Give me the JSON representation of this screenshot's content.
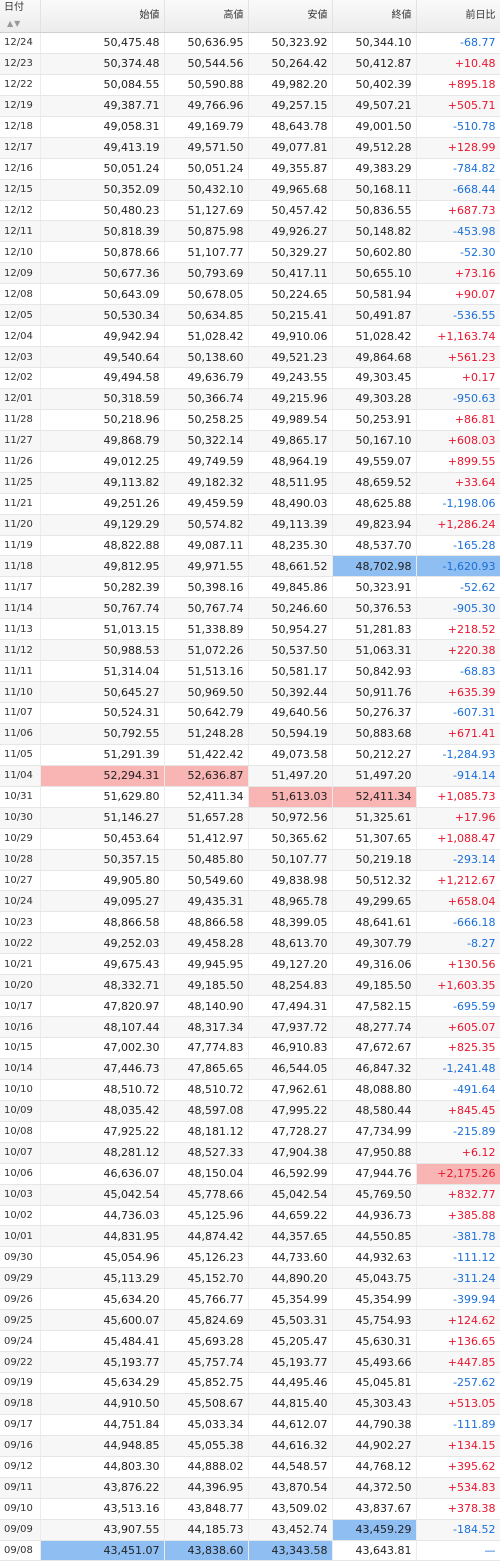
{
  "headers": {
    "date": "日付",
    "open": "始値",
    "high": "高値",
    "low": "安値",
    "close": "終値",
    "change": "前日比"
  },
  "sort_icon": "▲▼",
  "colors": {
    "up": "#e8152e",
    "down": "#1a6fd8",
    "highlight_red": "#f9b4b4",
    "highlight_blue": "#8fbef2"
  },
  "rows": [
    {
      "date": "12/24",
      "open": "50,475.48",
      "high": "50,636.95",
      "low": "50,323.92",
      "close": "50,344.10",
      "change": "-68.77"
    },
    {
      "date": "12/23",
      "open": "50,374.48",
      "high": "50,544.56",
      "low": "50,264.42",
      "close": "50,412.87",
      "change": "+10.48"
    },
    {
      "date": "12/22",
      "open": "50,084.55",
      "high": "50,590.88",
      "low": "49,982.20",
      "close": "50,402.39",
      "change": "+895.18"
    },
    {
      "date": "12/19",
      "open": "49,387.71",
      "high": "49,766.96",
      "low": "49,257.15",
      "close": "49,507.21",
      "change": "+505.71"
    },
    {
      "date": "12/18",
      "open": "49,058.31",
      "high": "49,169.79",
      "low": "48,643.78",
      "close": "49,001.50",
      "change": "-510.78"
    },
    {
      "date": "12/17",
      "open": "49,413.19",
      "high": "49,571.50",
      "low": "49,077.81",
      "close": "49,512.28",
      "change": "+128.99"
    },
    {
      "date": "12/16",
      "open": "50,051.24",
      "high": "50,051.24",
      "low": "49,355.87",
      "close": "49,383.29",
      "change": "-784.82"
    },
    {
      "date": "12/15",
      "open": "50,352.09",
      "high": "50,432.10",
      "low": "49,965.68",
      "close": "50,168.11",
      "change": "-668.44"
    },
    {
      "date": "12/12",
      "open": "50,480.23",
      "high": "51,127.69",
      "low": "50,457.42",
      "close": "50,836.55",
      "change": "+687.73"
    },
    {
      "date": "12/11",
      "open": "50,818.39",
      "high": "50,875.98",
      "low": "49,926.27",
      "close": "50,148.82",
      "change": "-453.98"
    },
    {
      "date": "12/10",
      "open": "50,878.66",
      "high": "51,107.77",
      "low": "50,329.27",
      "close": "50,602.80",
      "change": "-52.30"
    },
    {
      "date": "12/09",
      "open": "50,677.36",
      "high": "50,793.69",
      "low": "50,417.11",
      "close": "50,655.10",
      "change": "+73.16"
    },
    {
      "date": "12/08",
      "open": "50,643.09",
      "high": "50,678.05",
      "low": "50,224.65",
      "close": "50,581.94",
      "change": "+90.07"
    },
    {
      "date": "12/05",
      "open": "50,530.34",
      "high": "50,634.85",
      "low": "50,215.41",
      "close": "50,491.87",
      "change": "-536.55"
    },
    {
      "date": "12/04",
      "open": "49,942.94",
      "high": "51,028.42",
      "low": "49,910.06",
      "close": "51,028.42",
      "change": "+1,163.74"
    },
    {
      "date": "12/03",
      "open": "49,540.64",
      "high": "50,138.60",
      "low": "49,521.23",
      "close": "49,864.68",
      "change": "+561.23"
    },
    {
      "date": "12/02",
      "open": "49,494.58",
      "high": "49,636.79",
      "low": "49,243.55",
      "close": "49,303.45",
      "change": "+0.17"
    },
    {
      "date": "12/01",
      "open": "50,318.59",
      "high": "50,366.74",
      "low": "49,215.96",
      "close": "49,303.28",
      "change": "-950.63"
    },
    {
      "date": "11/28",
      "open": "50,218.96",
      "high": "50,258.25",
      "low": "49,989.54",
      "close": "50,253.91",
      "change": "+86.81"
    },
    {
      "date": "11/27",
      "open": "49,868.79",
      "high": "50,322.14",
      "low": "49,865.17",
      "close": "50,167.10",
      "change": "+608.03"
    },
    {
      "date": "11/26",
      "open": "49,012.25",
      "high": "49,749.59",
      "low": "48,964.19",
      "close": "49,559.07",
      "change": "+899.55"
    },
    {
      "date": "11/25",
      "open": "49,113.82",
      "high": "49,182.32",
      "low": "48,511.95",
      "close": "48,659.52",
      "change": "+33.64"
    },
    {
      "date": "11/21",
      "open": "49,251.26",
      "high": "49,459.59",
      "low": "48,490.03",
      "close": "48,625.88",
      "change": "-1,198.06"
    },
    {
      "date": "11/20",
      "open": "49,129.29",
      "high": "50,574.82",
      "low": "49,113.39",
      "close": "49,823.94",
      "change": "+1,286.24"
    },
    {
      "date": "11/19",
      "open": "48,822.88",
      "high": "49,087.11",
      "low": "48,235.30",
      "close": "48,537.70",
      "change": "-165.28"
    },
    {
      "date": "11/18",
      "open": "49,812.95",
      "high": "49,971.55",
      "low": "48,661.52",
      "close": "48,702.98",
      "change": "-1,620.93"
    },
    {
      "date": "11/17",
      "open": "50,282.39",
      "high": "50,398.16",
      "low": "49,845.86",
      "close": "50,323.91",
      "change": "-52.62"
    },
    {
      "date": "11/14",
      "open": "50,767.74",
      "high": "50,767.74",
      "low": "50,246.60",
      "close": "50,376.53",
      "change": "-905.30"
    },
    {
      "date": "11/13",
      "open": "51,013.15",
      "high": "51,338.89",
      "low": "50,954.27",
      "close": "51,281.83",
      "change": "+218.52"
    },
    {
      "date": "11/12",
      "open": "50,988.53",
      "high": "51,072.26",
      "low": "50,537.50",
      "close": "51,063.31",
      "change": "+220.38"
    },
    {
      "date": "11/11",
      "open": "51,314.04",
      "high": "51,513.16",
      "low": "50,581.17",
      "close": "50,842.93",
      "change": "-68.83"
    },
    {
      "date": "11/10",
      "open": "50,645.27",
      "high": "50,969.50",
      "low": "50,392.44",
      "close": "50,911.76",
      "change": "+635.39"
    },
    {
      "date": "11/07",
      "open": "50,524.31",
      "high": "50,642.79",
      "low": "49,640.56",
      "close": "50,276.37",
      "change": "-607.31"
    },
    {
      "date": "11/06",
      "open": "50,792.55",
      "high": "51,248.28",
      "low": "50,594.19",
      "close": "50,883.68",
      "change": "+671.41"
    },
    {
      "date": "11/05",
      "open": "51,291.39",
      "high": "51,422.42",
      "low": "49,073.58",
      "close": "50,212.27",
      "change": "-1,284.93"
    },
    {
      "date": "11/04",
      "open": "52,294.31",
      "high": "52,636.87",
      "low": "51,497.20",
      "close": "51,497.20",
      "change": "-914.14"
    },
    {
      "date": "10/31",
      "open": "51,629.80",
      "high": "52,411.34",
      "low": "51,613.03",
      "close": "52,411.34",
      "change": "+1,085.73"
    },
    {
      "date": "10/30",
      "open": "51,146.27",
      "high": "51,657.28",
      "low": "50,972.56",
      "close": "51,325.61",
      "change": "+17.96"
    },
    {
      "date": "10/29",
      "open": "50,453.64",
      "high": "51,412.97",
      "low": "50,365.62",
      "close": "51,307.65",
      "change": "+1,088.47"
    },
    {
      "date": "10/28",
      "open": "50,357.15",
      "high": "50,485.80",
      "low": "50,107.77",
      "close": "50,219.18",
      "change": "-293.14"
    },
    {
      "date": "10/27",
      "open": "49,905.80",
      "high": "50,549.60",
      "low": "49,838.98",
      "close": "50,512.32",
      "change": "+1,212.67"
    },
    {
      "date": "10/24",
      "open": "49,095.27",
      "high": "49,435.31",
      "low": "48,965.78",
      "close": "49,299.65",
      "change": "+658.04"
    },
    {
      "date": "10/23",
      "open": "48,866.58",
      "high": "48,866.58",
      "low": "48,399.05",
      "close": "48,641.61",
      "change": "-666.18"
    },
    {
      "date": "10/22",
      "open": "49,252.03",
      "high": "49,458.28",
      "low": "48,613.70",
      "close": "49,307.79",
      "change": "-8.27"
    },
    {
      "date": "10/21",
      "open": "49,675.43",
      "high": "49,945.95",
      "low": "49,127.20",
      "close": "49,316.06",
      "change": "+130.56"
    },
    {
      "date": "10/20",
      "open": "48,332.71",
      "high": "49,185.50",
      "low": "48,254.83",
      "close": "49,185.50",
      "change": "+1,603.35"
    },
    {
      "date": "10/17",
      "open": "47,820.97",
      "high": "48,140.90",
      "low": "47,494.31",
      "close": "47,582.15",
      "change": "-695.59"
    },
    {
      "date": "10/16",
      "open": "48,107.44",
      "high": "48,317.34",
      "low": "47,937.72",
      "close": "48,277.74",
      "change": "+605.07"
    },
    {
      "date": "10/15",
      "open": "47,002.30",
      "high": "47,774.83",
      "low": "46,910.83",
      "close": "47,672.67",
      "change": "+825.35"
    },
    {
      "date": "10/14",
      "open": "47,446.73",
      "high": "47,865.65",
      "low": "46,544.05",
      "close": "46,847.32",
      "change": "-1,241.48"
    },
    {
      "date": "10/10",
      "open": "48,510.72",
      "high": "48,510.72",
      "low": "47,962.61",
      "close": "48,088.80",
      "change": "-491.64"
    },
    {
      "date": "10/09",
      "open": "48,035.42",
      "high": "48,597.08",
      "low": "47,995.22",
      "close": "48,580.44",
      "change": "+845.45"
    },
    {
      "date": "10/08",
      "open": "47,925.22",
      "high": "48,181.12",
      "low": "47,728.27",
      "close": "47,734.99",
      "change": "-215.89"
    },
    {
      "date": "10/07",
      "open": "48,281.12",
      "high": "48,527.33",
      "low": "47,904.38",
      "close": "47,950.88",
      "change": "+6.12"
    },
    {
      "date": "10/06",
      "open": "46,636.07",
      "high": "48,150.04",
      "low": "46,592.99",
      "close": "47,944.76",
      "change": "+2,175.26"
    },
    {
      "date": "10/03",
      "open": "45,042.54",
      "high": "45,778.66",
      "low": "45,042.54",
      "close": "45,769.50",
      "change": "+832.77"
    },
    {
      "date": "10/02",
      "open": "44,736.03",
      "high": "45,125.96",
      "low": "44,659.22",
      "close": "44,936.73",
      "change": "+385.88"
    },
    {
      "date": "10/01",
      "open": "44,831.95",
      "high": "44,874.42",
      "low": "44,357.65",
      "close": "44,550.85",
      "change": "-381.78"
    },
    {
      "date": "09/30",
      "open": "45,054.96",
      "high": "45,126.23",
      "low": "44,733.60",
      "close": "44,932.63",
      "change": "-111.12"
    },
    {
      "date": "09/29",
      "open": "45,113.29",
      "high": "45,152.70",
      "low": "44,890.20",
      "close": "45,043.75",
      "change": "-311.24"
    },
    {
      "date": "09/26",
      "open": "45,634.20",
      "high": "45,766.77",
      "low": "45,354.99",
      "close": "45,354.99",
      "change": "-399.94"
    },
    {
      "date": "09/25",
      "open": "45,600.07",
      "high": "45,824.69",
      "low": "45,503.31",
      "close": "45,754.93",
      "change": "+124.62"
    },
    {
      "date": "09/24",
      "open": "45,484.41",
      "high": "45,693.28",
      "low": "45,205.47",
      "close": "45,630.31",
      "change": "+136.65"
    },
    {
      "date": "09/22",
      "open": "45,193.77",
      "high": "45,757.74",
      "low": "45,193.77",
      "close": "45,493.66",
      "change": "+447.85"
    },
    {
      "date": "09/19",
      "open": "45,634.29",
      "high": "45,852.75",
      "low": "44,495.46",
      "close": "45,045.81",
      "change": "-257.62"
    },
    {
      "date": "09/18",
      "open": "44,910.50",
      "high": "45,508.67",
      "low": "44,815.40",
      "close": "45,303.43",
      "change": "+513.05"
    },
    {
      "date": "09/17",
      "open": "44,751.84",
      "high": "45,033.34",
      "low": "44,612.07",
      "close": "44,790.38",
      "change": "-111.89"
    },
    {
      "date": "09/16",
      "open": "44,948.85",
      "high": "45,055.38",
      "low": "44,616.32",
      "close": "44,902.27",
      "change": "+134.15"
    },
    {
      "date": "09/12",
      "open": "44,803.30",
      "high": "44,888.02",
      "low": "44,548.57",
      "close": "44,768.12",
      "change": "+395.62"
    },
    {
      "date": "09/11",
      "open": "43,876.22",
      "high": "44,396.95",
      "low": "43,870.54",
      "close": "44,372.50",
      "change": "+534.83"
    },
    {
      "date": "09/10",
      "open": "43,513.16",
      "high": "43,848.77",
      "low": "43,509.02",
      "close": "43,837.67",
      "change": "+378.38"
    },
    {
      "date": "09/09",
      "open": "43,907.55",
      "high": "44,185.73",
      "low": "43,452.74",
      "close": "43,459.29",
      "change": "-184.52"
    },
    {
      "date": "09/08",
      "open": "43,451.07",
      "high": "43,838.60",
      "low": "43,343.58",
      "close": "43,643.81",
      "change": "—"
    }
  ]
}
